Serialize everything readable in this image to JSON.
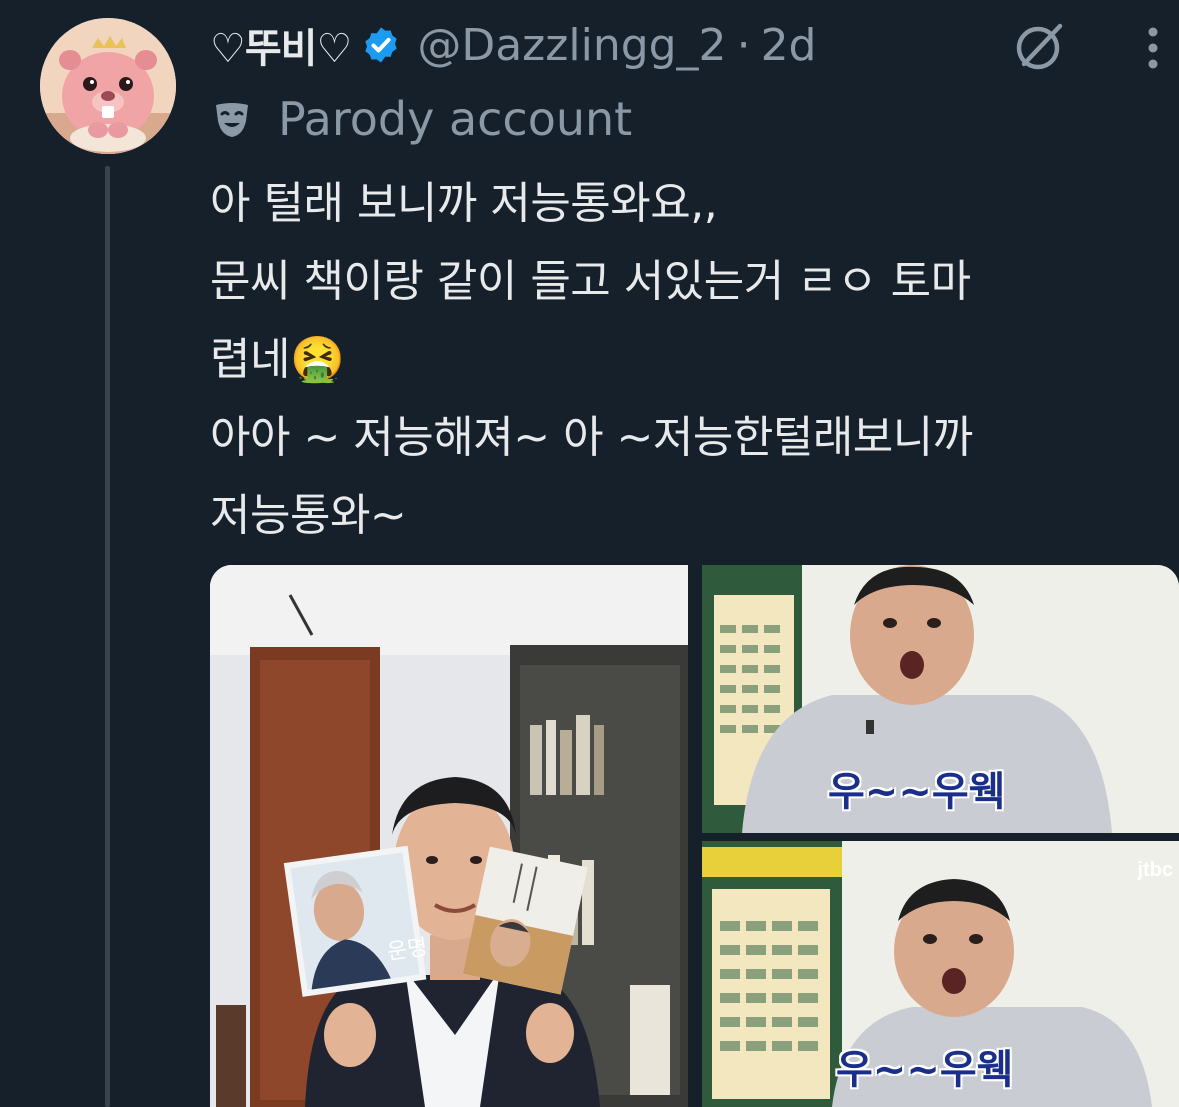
{
  "tweet": {
    "display_name": "♡뚜비♡",
    "handle": "@Dazzlingg_2",
    "separator": "·",
    "time": "2d",
    "parody_label": "Parody account",
    "text": "아 털래 보니까 저능통와요,,\n문씨 책이랑 같이 들고 서있는거 ㄹㅇ 토마\n렵네🤮\n아아 ~ 저능해져~ 아 ~저능한털래보니까\n저능통와~"
  },
  "icons": {
    "verified": "verified-badge-icon",
    "grok": "grok-icon",
    "more": "more-options-icon",
    "parody": "theater-mask-icon"
  },
  "media": {
    "right_top_caption": "우~~우웩",
    "right_bottom_caption": "우~~우웩",
    "book_left_title": "운명",
    "broadcaster_logo": "jtbc"
  },
  "colors": {
    "background": "#15202b",
    "text_primary": "#e7e9ea",
    "text_secondary": "#8b98a5",
    "verified_blue": "#1d9bf0",
    "thread_line": "#38444d"
  }
}
